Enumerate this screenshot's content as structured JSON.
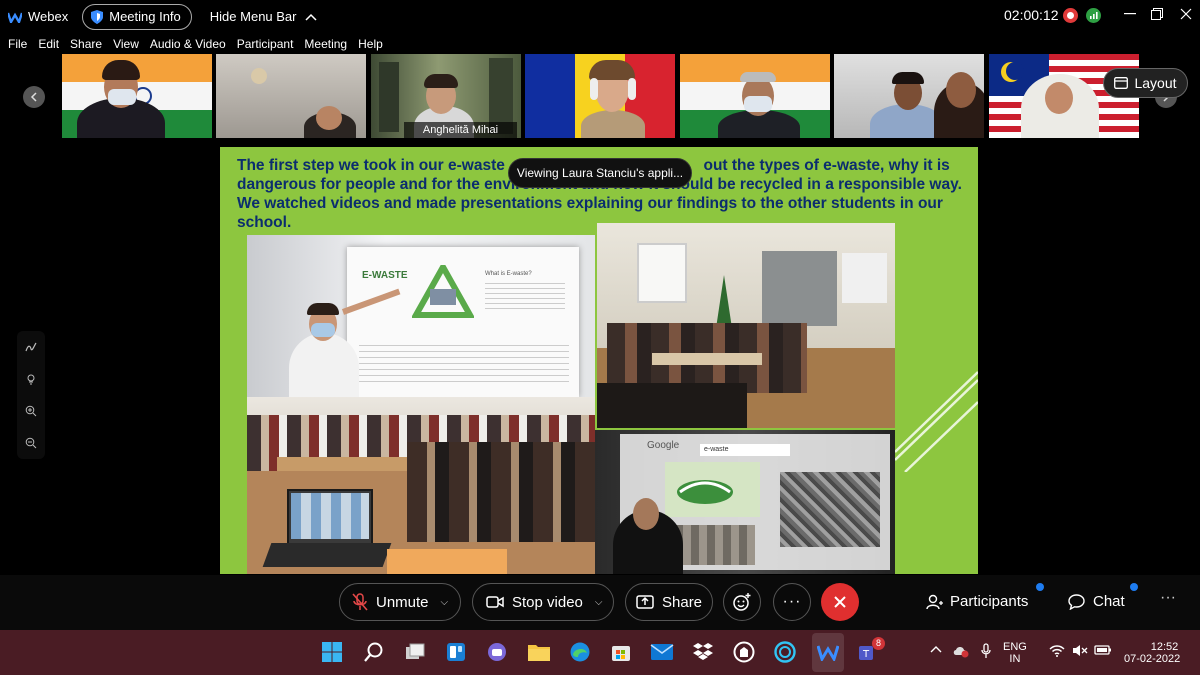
{
  "titlebar": {
    "app_name": "Webex",
    "meeting_info_label": "Meeting Info",
    "hide_menu_label": "Hide Menu Bar",
    "timer": "02:00:12"
  },
  "menu": [
    "File",
    "Edit",
    "Share",
    "View",
    "Audio & Video",
    "Participant",
    "Meeting",
    "Help"
  ],
  "strip": {
    "active_name": "Anghelită Mihai",
    "layout_label": "Layout"
  },
  "slide": {
    "text_before": "The first step we took in our e-waste",
    "text_after": "out the types of e-waste, why it is dangerous for people and for the environment and how it should be recycled in a responsible way. We watched videos and made presentations explaining our findings to the other students in our school.",
    "poster_title": "E-WASTE",
    "poster_subtitle": "What is E-waste?",
    "search_query": "e-waste",
    "search_brand": "Google"
  },
  "viewing_notice": "Viewing Laura Stanciu's appli...",
  "controls": {
    "unmute": "Unmute",
    "stop_video": "Stop video",
    "share": "Share",
    "participants": "Participants",
    "chat": "Chat"
  },
  "taskbar": {
    "lang": "ENG",
    "region": "IN",
    "time": "12:52",
    "date": "07-02-2022",
    "teams_badge": "8"
  },
  "colors": {
    "slide_bg": "#8dc63f",
    "slide_text": "#0b2d6e",
    "accent_blue": "#1da1e8",
    "end_red": "#e02f2f",
    "taskbar": "#4a1c24"
  }
}
